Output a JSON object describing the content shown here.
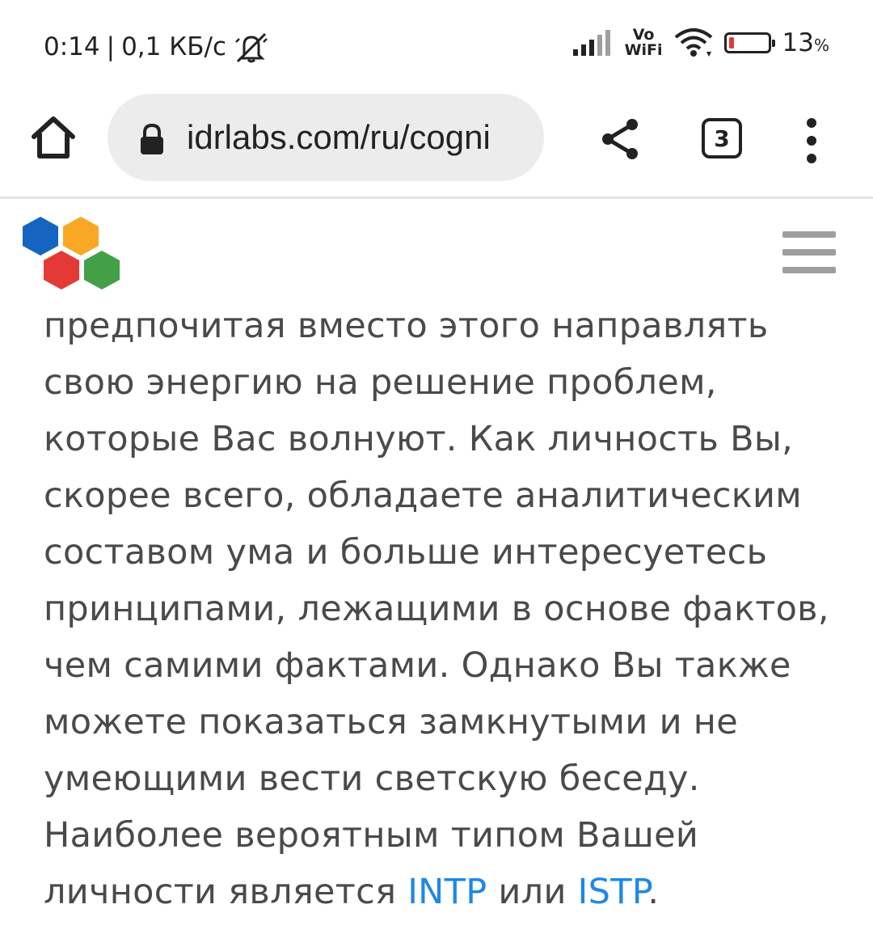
{
  "status": {
    "time": "0:14",
    "separator": "|",
    "speed": "0,1 КБ/с",
    "vowifi_top": "Vo",
    "vowifi_bottom": "WiFi",
    "battery_percent": "13",
    "battery_percent_sign": "%",
    "battery_level": 0.13,
    "battery_fill_color": "#e53935"
  },
  "browser": {
    "url": "idrlabs.com/ru/cogni",
    "tab_count": "3",
    "icons": [
      "home-icon",
      "lock-icon",
      "share-icon",
      "tabs-icon",
      "more-vert-icon"
    ]
  },
  "site": {
    "logo_colors": [
      "#1565c0",
      "#f9a825",
      "#e53935",
      "#43a047"
    ],
    "menu_icon": "hamburger-icon"
  },
  "article": {
    "lines": [
      "предпочитая вместо этого направлять",
      "свою энергию на решение проблем,",
      "которые Вас волнуют. Как личность Вы,",
      "скорее всего, обладаете аналитическим",
      "составом ума и больше интересуетесь",
      "принципами, лежащими в основе фактов,",
      "чем самими фактами. Однако Вы также",
      "можете показаться замкнутыми и не",
      "умеющими вести светскую беседу.",
      "Наиболее вероятным типом Вашей"
    ],
    "last_line_prefix": "личности является ",
    "link1": "INTP",
    "connector": " или ",
    "link2": "ISTP",
    "last_line_suffix": ".",
    "link_color": "#1e88e5",
    "text_color": "#4a4a4a"
  }
}
